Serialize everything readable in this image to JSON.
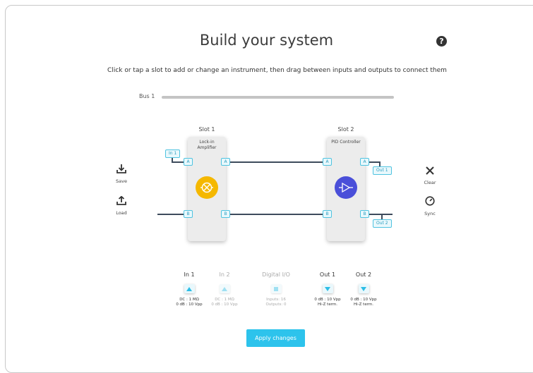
{
  "title": "Build your system",
  "help_glyph": "?",
  "subtitle": "Click or tap a slot to add or change an instrument, then drag between inputs and outputs to connect them",
  "bus": {
    "label": "Bus 1"
  },
  "slots": [
    {
      "label": "Slot 1",
      "instrument": "Lock-in\nAmplifier",
      "color": "#f5b800",
      "icon": "mixer-icon"
    },
    {
      "label": "Slot 2",
      "instrument": "PID Controller",
      "color": "#4a4fd9",
      "icon": "amplifier-icon"
    }
  ],
  "ports": {
    "a": "A",
    "b": "B"
  },
  "tags": {
    "in1": "In 1",
    "out1": "Out 1",
    "out2": "Out 2"
  },
  "side_buttons": {
    "save": "Save",
    "load": "Load",
    "clear": "Clear",
    "sync": "Sync"
  },
  "io": [
    {
      "name": "In 1",
      "desc": "DC : 1 MΩ\n0 dB : 10 Vpp",
      "enabled": true,
      "icon": "triangle-up-icon"
    },
    {
      "name": "In 2",
      "desc": "DC : 1 MΩ\n0 dB : 10 Vpp",
      "enabled": false,
      "icon": "triangle-up-icon"
    },
    {
      "name": "Digital I/O",
      "desc": "Inputs: 16\nOutputs: 0",
      "enabled": false,
      "icon": "square-icon"
    },
    {
      "name": "Out 1",
      "desc": "0 dB : 10 Vpp\nHi-Z term.",
      "enabled": true,
      "icon": "triangle-down-icon"
    },
    {
      "name": "Out 2",
      "desc": "0 dB : 10 Vpp\nHi-Z term.",
      "enabled": true,
      "icon": "triangle-down-icon"
    }
  ],
  "apply_label": "Apply changes"
}
